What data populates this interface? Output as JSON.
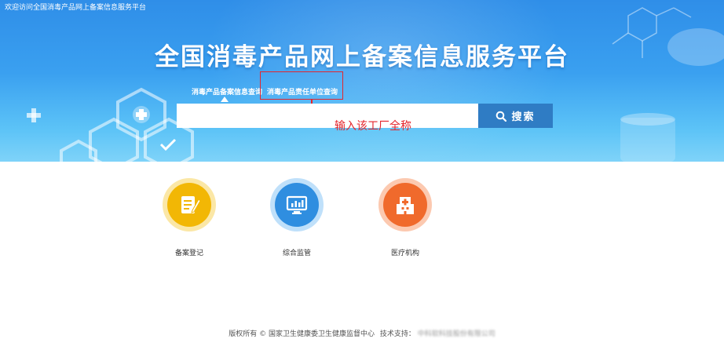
{
  "header": {
    "welcome_text": "欢迎访问全国消毒产品网上备案信息服务平台",
    "title": "全国消毒产品网上备案信息服务平台"
  },
  "search": {
    "tabs": [
      {
        "label": "消毒产品备案信息查询"
      },
      {
        "label": "消毒产品责任单位查询"
      }
    ],
    "placeholder": "",
    "button_label": "搜索",
    "annotation": "输入该工厂全称"
  },
  "cards": [
    {
      "label": "备案登记",
      "icon": "registration-icon",
      "color": "#f2b705"
    },
    {
      "label": "综合监管",
      "icon": "monitor-icon",
      "color": "#2f8ee0"
    },
    {
      "label": "医疗机构",
      "icon": "hospital-icon",
      "color": "#f06a2c"
    }
  ],
  "footer": {
    "copyright": "版权所有 © 国家卫生健康委卫生健康监督中心",
    "support_label": "技术支持：",
    "support_value": "中科软科技股份有限公司"
  },
  "colors": {
    "banner": "#3aa0f0",
    "search_button": "#2f7cc4",
    "annotation_red": "#e4262d"
  }
}
